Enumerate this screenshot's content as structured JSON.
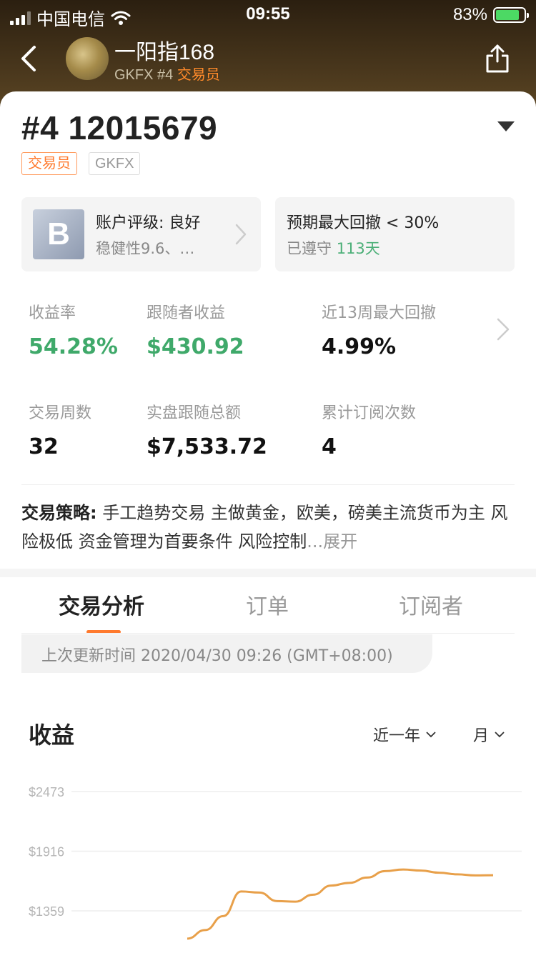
{
  "status_bar": {
    "carrier": "中国电信",
    "time": "09:55",
    "battery_pct": "83%"
  },
  "header": {
    "trader_name": "一阳指168",
    "broker": "GKFX",
    "rank": "#4",
    "role": "交易员"
  },
  "account": {
    "title": "#4 12015679",
    "tags": {
      "role": "交易员",
      "broker": "GKFX"
    }
  },
  "rating_box": {
    "grade": "B",
    "title": "账户评级: 良好",
    "subtitle": "稳健性9.6、…"
  },
  "drawdown_box": {
    "title": "预期最大回撤 < 30%",
    "prefix": "已遵守",
    "days": "113天"
  },
  "stats": {
    "return_rate": {
      "label": "收益率",
      "value": "54.28%"
    },
    "follower_profit": {
      "label": "跟随者收益",
      "value": "$430.92"
    },
    "max_drawdown_13w": {
      "label": "近13周最大回撤",
      "value": "4.99%"
    },
    "trade_weeks": {
      "label": "交易周数",
      "value": "32"
    },
    "live_follow_total": {
      "label": "实盘跟随总额",
      "value": "$7,533.72"
    },
    "subscriptions": {
      "label": "累计订阅次数",
      "value": "4"
    }
  },
  "strategy": {
    "label": "交易策略:",
    "text": " 手工趋势交易 主做黄金，欧美，磅美主流货币为主 风险极低 资金管理为首要条件 风险控制",
    "more": "...展开"
  },
  "tabs": [
    {
      "label": "交易分析",
      "active": true
    },
    {
      "label": "订单",
      "active": false
    },
    {
      "label": "订阅者",
      "active": false
    }
  ],
  "update_time": "上次更新时间 2020/04/30 09:26 (GMT+08:00)",
  "profit_section": {
    "title": "收益",
    "range_filter": "近一年",
    "period_filter": "月"
  },
  "colors": {
    "accent": "#ff7a2e",
    "positive": "#3fa96a",
    "line": "#e8a04a"
  },
  "chart_data": {
    "type": "line",
    "title": "",
    "y_ticks": [
      "$2473",
      "$1916",
      "$1359"
    ],
    "ylim": [
      1100,
      2550
    ],
    "x": [
      0,
      1,
      2,
      3,
      4,
      5,
      6,
      7,
      8,
      9,
      10,
      11,
      12,
      13,
      14,
      15,
      16,
      17
    ],
    "series": [
      {
        "values": [
          1100,
          1180,
          1310,
          1540,
          1530,
          1450,
          1445,
          1510,
          1595,
          1620,
          1670,
          1730,
          1745,
          1735,
          1715,
          1700,
          1690,
          1692
        ]
      }
    ]
  }
}
